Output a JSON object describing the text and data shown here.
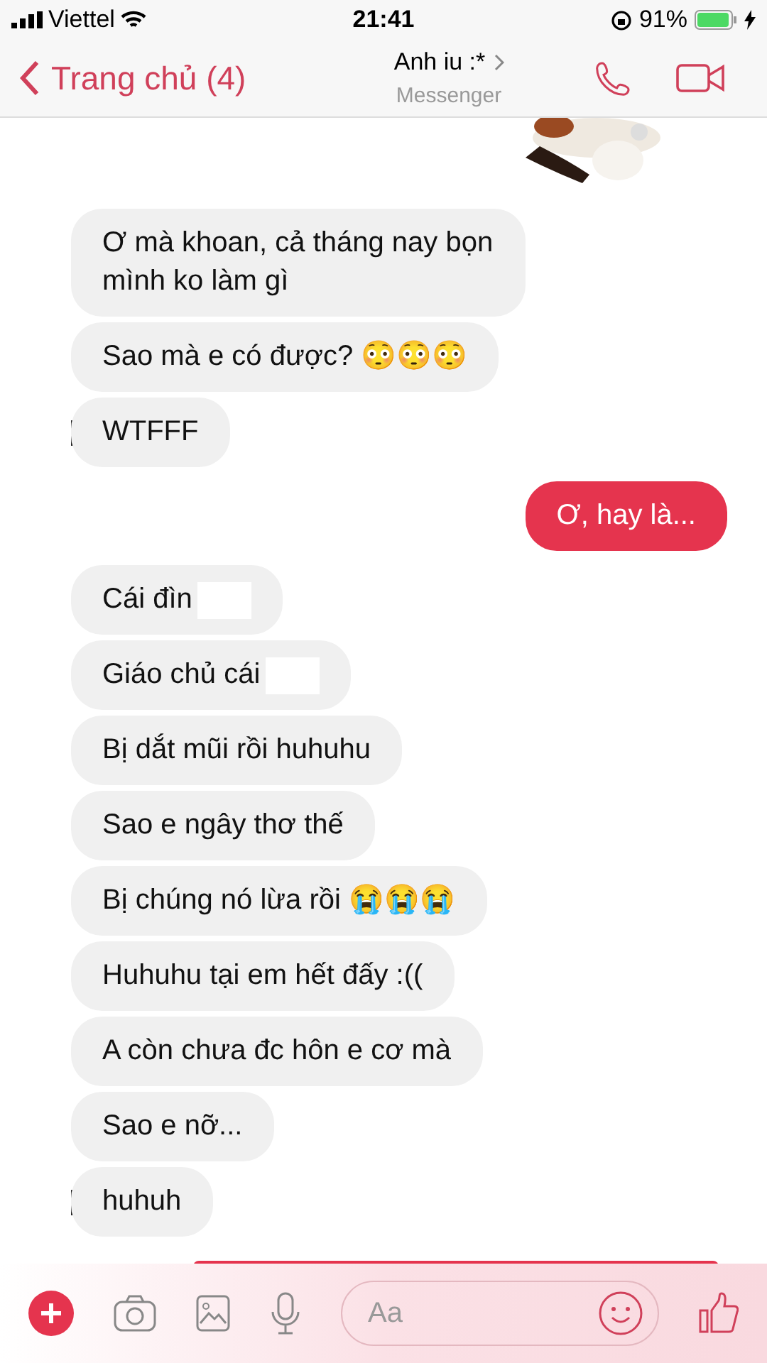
{
  "status_bar": {
    "carrier": "Viettel",
    "time": "21:41",
    "battery": "91%"
  },
  "header": {
    "back_label": "Trang chủ (4)",
    "contact_name": "Anh iu :*",
    "subtitle": "Messenger"
  },
  "messages": [
    {
      "kind": "incoming",
      "text": "Ơ mà khoan, cả tháng nay bọn mình ko làm gì",
      "avatar": false,
      "redacted": false
    },
    {
      "kind": "incoming",
      "text": "Sao mà e có được? 😳😳😳",
      "avatar": false,
      "redacted": false
    },
    {
      "kind": "incoming",
      "text": "WTFFF",
      "avatar": true,
      "redacted": false
    },
    {
      "kind": "outgoing",
      "text": "Ơ, hay là...",
      "avatar": false,
      "redacted": false
    },
    {
      "kind": "incoming",
      "text": "Cái đìn",
      "avatar": false,
      "redacted": true
    },
    {
      "kind": "incoming",
      "text": "Giáo chủ cái",
      "avatar": false,
      "redacted": true
    },
    {
      "kind": "incoming",
      "text": "Bị dắt mũi rồi huhuhu",
      "avatar": false,
      "redacted": false
    },
    {
      "kind": "incoming",
      "text": "Sao e ngây thơ thế",
      "avatar": false,
      "redacted": false
    },
    {
      "kind": "incoming",
      "text": "Bị chúng nó lừa rồi 😭😭😭",
      "avatar": false,
      "redacted": false
    },
    {
      "kind": "incoming",
      "text": "Huhuhu tại em hết đấy :((",
      "avatar": false,
      "redacted": false
    },
    {
      "kind": "incoming",
      "text": "A còn chưa đc hôn e cơ mà",
      "avatar": false,
      "redacted": false
    },
    {
      "kind": "incoming",
      "text": "Sao e nỡ...",
      "avatar": false,
      "redacted": false
    },
    {
      "kind": "incoming",
      "text": "huhuh",
      "avatar": true,
      "redacted": false
    }
  ],
  "composer": {
    "placeholder": "Aa"
  }
}
